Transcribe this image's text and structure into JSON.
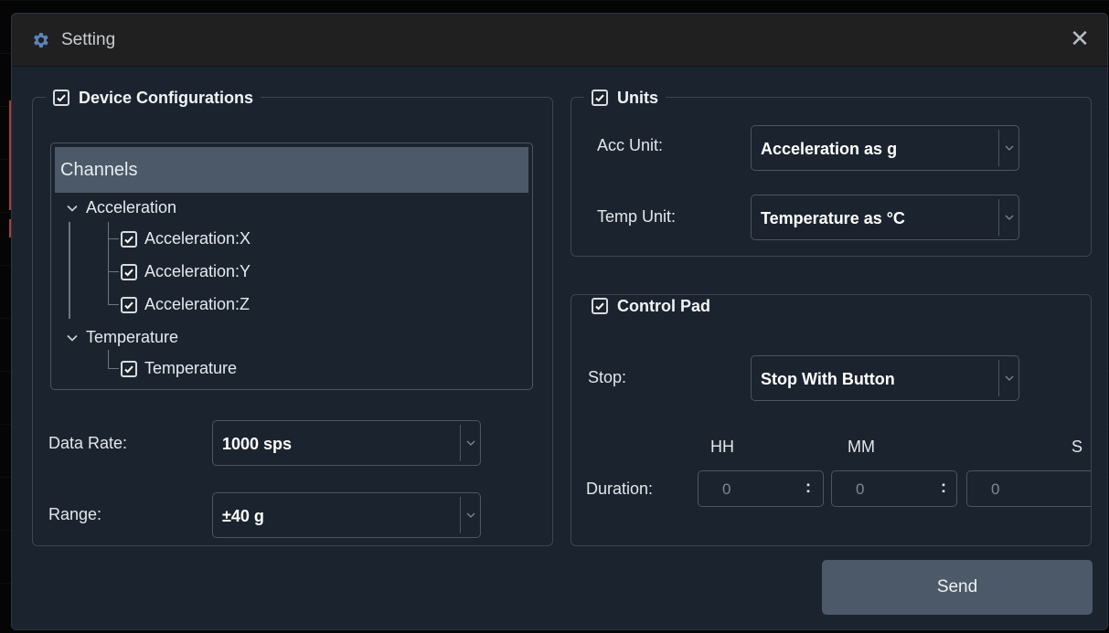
{
  "dialog": {
    "title": "Setting",
    "title_icon": "gear-icon",
    "close_glyph": "✕"
  },
  "device": {
    "legend": "Device Configurations",
    "enabled": true,
    "tree": {
      "header": "Channels",
      "groups": [
        {
          "label": "Acceleration",
          "items": [
            "Acceleration:X",
            "Acceleration:Y",
            "Acceleration:Z"
          ]
        },
        {
          "label": "Temperature",
          "items": [
            "Temperature"
          ]
        }
      ]
    },
    "data_rate": {
      "label": "Data Rate:",
      "value": "1000 sps"
    },
    "range": {
      "label": "Range:",
      "value": "±40 g"
    }
  },
  "units": {
    "legend": "Units",
    "enabled": true,
    "acc": {
      "label": "Acc Unit:",
      "value": "Acceleration as g"
    },
    "temp": {
      "label": "Temp Unit:",
      "value": "Temperature as °C"
    }
  },
  "control": {
    "legend": "Control Pad",
    "enabled": true,
    "stop": {
      "label": "Stop:",
      "value": "Stop With Button"
    },
    "duration": {
      "label": "Duration:",
      "headers": [
        "HH",
        "MM",
        "S"
      ],
      "hh": "0",
      "mm": "0",
      "ss": "0",
      "separator": ":"
    }
  },
  "send_label": "Send",
  "colors": {
    "dialog_bg": "#1b242e",
    "titlebar_bg": "#202020",
    "accent": "#4b5968",
    "border": "#4a5661"
  }
}
